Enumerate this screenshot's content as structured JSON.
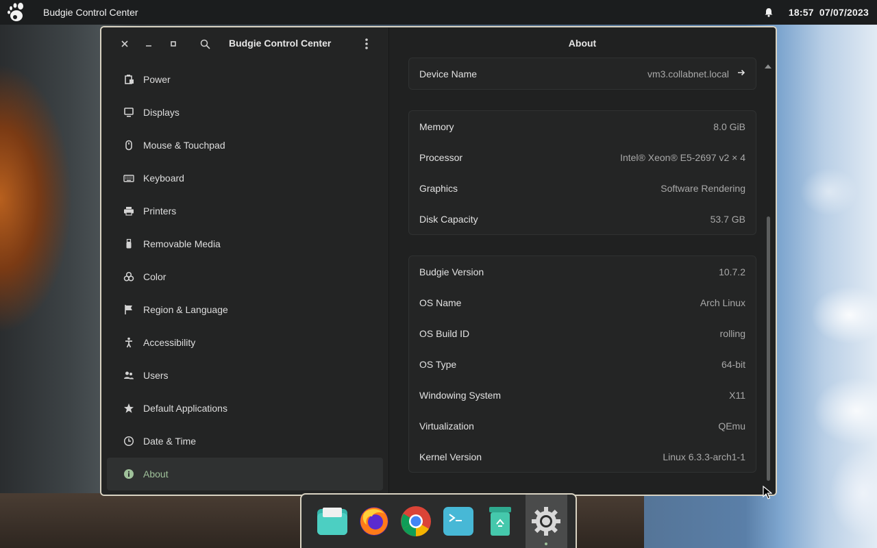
{
  "topbar": {
    "app_title": "Budgie Control Center",
    "time": "18:57",
    "date": "07/07/2023",
    "icons": [
      "gnome-foot-icon",
      "bell-icon"
    ]
  },
  "window": {
    "sidebar_title": "Budgie Control Center",
    "content_title": "About",
    "sidebar_items": [
      {
        "label": "Power",
        "icon": "battery-icon"
      },
      {
        "label": "Displays",
        "icon": "monitor-icon"
      },
      {
        "label": "Mouse & Touchpad",
        "icon": "mouse-icon"
      },
      {
        "label": "Keyboard",
        "icon": "keyboard-icon"
      },
      {
        "label": "Printers",
        "icon": "printer-icon"
      },
      {
        "label": "Removable Media",
        "icon": "usb-drive-icon"
      },
      {
        "label": "Color",
        "icon": "color-circles-icon"
      },
      {
        "label": "Region & Language",
        "icon": "flag-icon"
      },
      {
        "label": "Accessibility",
        "icon": "accessibility-person-icon"
      },
      {
        "label": "Users",
        "icon": "users-icon"
      },
      {
        "label": "Default Applications",
        "icon": "star-icon"
      },
      {
        "label": "Date & Time",
        "icon": "clock-icon"
      },
      {
        "label": "About",
        "icon": "info-icon",
        "active": true
      }
    ],
    "device": {
      "label": "Device Name",
      "value": "vm3.collabnet.local"
    },
    "hardware": [
      {
        "label": "Memory",
        "value": "8.0 GiB"
      },
      {
        "label": "Processor",
        "value": "Intel® Xeon® E5-2697 v2 × 4"
      },
      {
        "label": "Graphics",
        "value": "Software Rendering"
      },
      {
        "label": "Disk Capacity",
        "value": "53.7 GB"
      }
    ],
    "software": [
      {
        "label": "Budgie Version",
        "value": "10.7.2"
      },
      {
        "label": "OS Name",
        "value": "Arch Linux"
      },
      {
        "label": "OS Build ID",
        "value": "rolling"
      },
      {
        "label": "OS Type",
        "value": "64-bit"
      },
      {
        "label": "Windowing System",
        "value": "X11"
      },
      {
        "label": "Virtualization",
        "value": "QEmu"
      },
      {
        "label": "Kernel Version",
        "value": "Linux 6.3.3-arch1-1"
      }
    ]
  },
  "dock": {
    "apps": [
      "files-app-icon",
      "firefox-app-icon",
      "chrome-app-icon",
      "terminal-app-icon",
      "trash-app-icon",
      "settings-app-icon"
    ],
    "active_app": "settings-app-icon"
  },
  "colors": {
    "accent": "#9fc19a",
    "window_border": "#d9d3c2",
    "panel_bg": "#1b1d1e"
  }
}
